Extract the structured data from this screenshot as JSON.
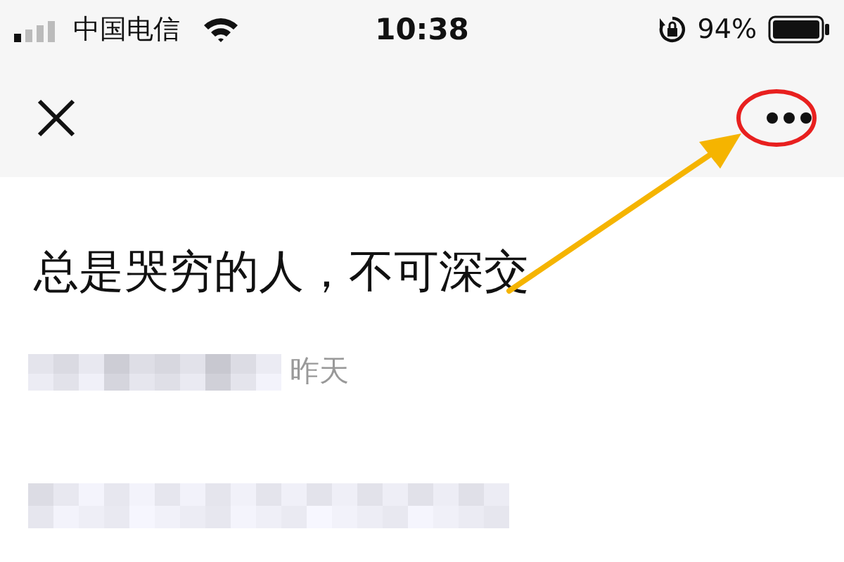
{
  "status_bar": {
    "carrier": "中国电信",
    "time": "10:38",
    "battery": "94%"
  },
  "article": {
    "title": "总是哭穷的人，不可深交",
    "date": "昨天"
  }
}
